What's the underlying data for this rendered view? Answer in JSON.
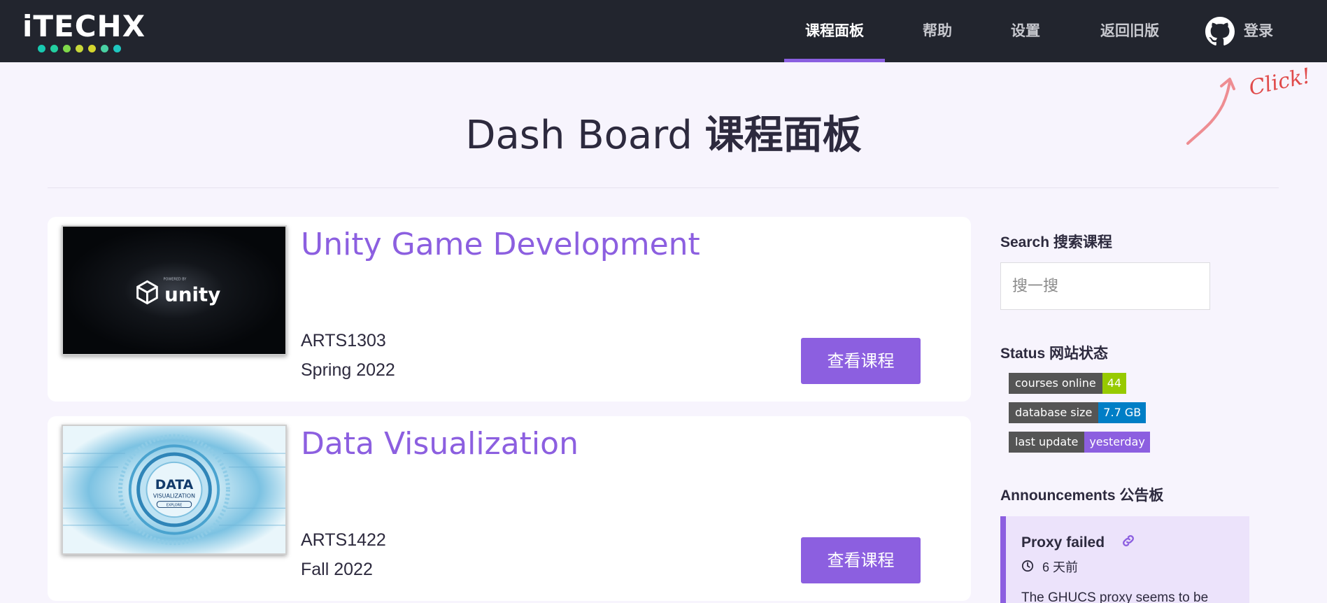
{
  "nav": {
    "logo_text": "iTECHX",
    "logo_dot_colors": [
      "#18c9b0",
      "#23cfa0",
      "#7fd94a",
      "#c8d83a",
      "#d5d62e",
      "#49d1a3",
      "#1fc7c0"
    ],
    "items": [
      {
        "label": "课程面板",
        "active": true
      },
      {
        "label": "帮助",
        "active": false
      },
      {
        "label": "设置",
        "active": false
      },
      {
        "label": "返回旧版",
        "active": false
      }
    ],
    "login_label": "登录",
    "github_icon": "github-icon"
  },
  "annotation": {
    "click_text": "Click!"
  },
  "page": {
    "title_en": "Dash Board",
    "title_zh": "课程面板"
  },
  "courses": [
    {
      "title": "Unity Game Development",
      "code": "ARTS1303",
      "term": "Spring 2022",
      "button": "查看课程",
      "thumbnail": "unity",
      "thumb_label": "unity",
      "thumb_caption": "POWERED BY"
    },
    {
      "title": "Data Visualization",
      "code": "ARTS1422",
      "term": "Fall 2022",
      "button": "查看课程",
      "thumbnail": "data-visualization",
      "thumb_label": "DATA",
      "thumb_caption": "VISUALIZATION",
      "thumb_pill": "EXPLORE"
    }
  ],
  "sidebar": {
    "search_heading": "Search 搜索课程",
    "search_placeholder": "搜一搜",
    "status_heading": "Status 网站状态",
    "badges": [
      {
        "key": "courses online",
        "value": "44",
        "color": "#97ca00"
      },
      {
        "key": "database size",
        "value": "7.7 GB",
        "color": "#007ec6"
      },
      {
        "key": "last update",
        "value": "yesterday",
        "color": "#8c5fe0"
      }
    ],
    "announcements_heading": "Announcements 公告板",
    "announcement": {
      "title": "Proxy failed",
      "time": "6 天前",
      "body": "The GHUCS proxy seems to be"
    }
  },
  "colors": {
    "accent": "#8c5fe0",
    "nav_bg": "#22252e",
    "page_bg": "#f7f4fd"
  }
}
